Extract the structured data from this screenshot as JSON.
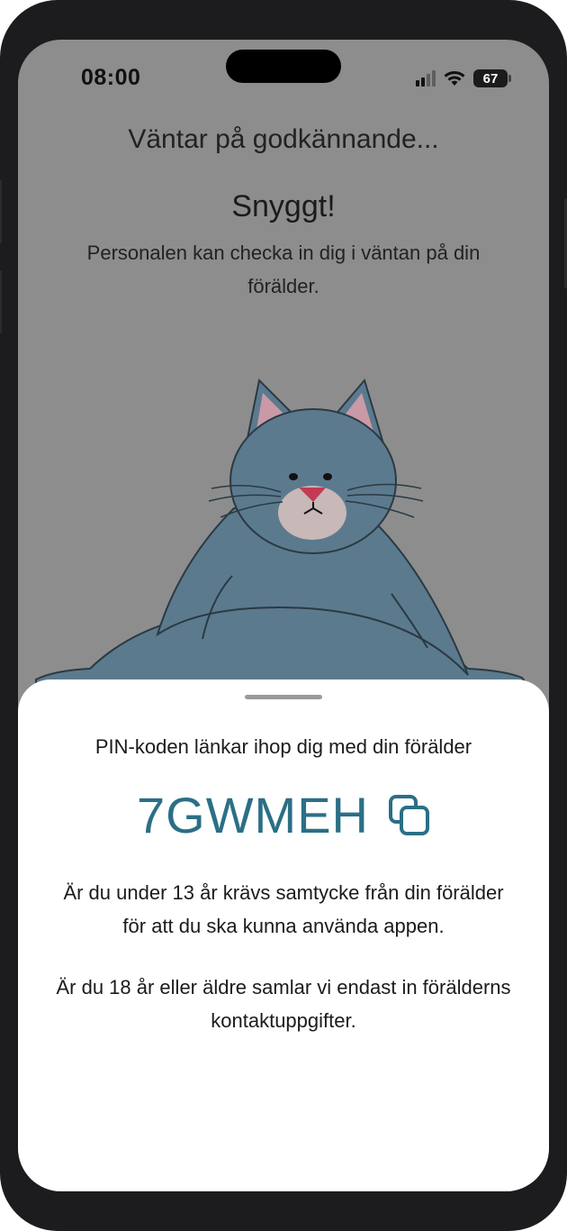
{
  "status_bar": {
    "time": "08:00",
    "battery": "67"
  },
  "header": {
    "waiting_title": "Väntar på godkännande..."
  },
  "hero": {
    "title": "Snyggt!",
    "subtitle": "Personalen kan checka in dig i väntan på din förälder."
  },
  "sheet": {
    "intro": "PIN-koden länkar ihop dig med din förälder",
    "pin_code": "7GWMEH",
    "paragraph_under_13": "Är du under 13 år krävs samtycke från din förälder för att du ska kunna använda appen.",
    "paragraph_18_plus": "Är du 18 år eller äldre samlar vi endast in förälderns kontaktuppgifter."
  },
  "icons": {
    "copy": "copy-icon",
    "wifi": "wifi-icon",
    "signal": "signal-icon",
    "battery": "battery-icon"
  },
  "colors": {
    "overlay_background": "#8d8d8d",
    "pin_accent": "#2b6f86",
    "device_frame": "#1c1c1e"
  }
}
